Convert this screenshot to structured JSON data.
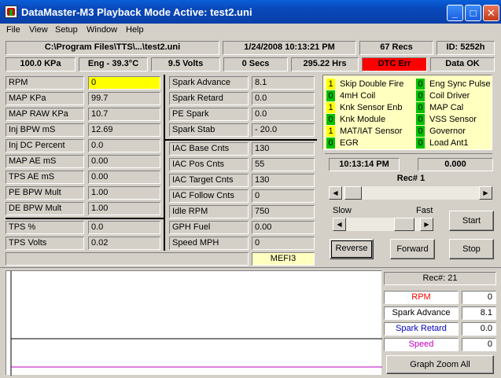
{
  "window": {
    "title": "DataMaster-M3  Playback Mode Active: test2.uni",
    "min_glyph": "_",
    "max_glyph": "□",
    "close_glyph": "✕",
    "icon": "datamaster-app-icon"
  },
  "menu": [
    "File",
    "View",
    "Setup",
    "Window",
    "Help"
  ],
  "status_top": {
    "file": "C:\\Program Files\\TTS\\...\\test2.uni",
    "datetime": "1/24/2008   10:13:21 PM",
    "recs": "67 Recs",
    "id": "ID: 5252h"
  },
  "status_second": {
    "kpa": "100.0 KPa",
    "eng": "Eng - 39.3°C",
    "volts": "9.5 Volts",
    "secs": "0 Secs",
    "hrs": "295.22 Hrs",
    "dtc": "DTC Err",
    "data": "Data OK"
  },
  "colors": {
    "dtc_bg": "#ff0000",
    "highlight": "#ffff00",
    "panel_yellow": "#ffffc0",
    "green_bit": "#00c000"
  },
  "col1": [
    {
      "label": "RPM",
      "value": "0"
    },
    {
      "label": "MAP KPa",
      "value": "99.7"
    },
    {
      "label": "MAP RAW KPa",
      "value": "10.7"
    },
    {
      "label": "Inj BPW mS",
      "value": "12.69"
    },
    {
      "label": "Inj DC Percent",
      "value": "0.0"
    },
    {
      "label": "MAP AE mS",
      "value": "0.00"
    },
    {
      "label": "TPS AE mS",
      "value": "0.00"
    },
    {
      "label": "PE BPW Mult",
      "value": "1.00"
    },
    {
      "label": "DE BPW Mult",
      "value": "1.00"
    },
    {
      "label": "TPS %",
      "value": "0.0"
    },
    {
      "label": "TPS Volts",
      "value": "0.02"
    }
  ],
  "col2": [
    {
      "label": "Spark Advance",
      "value": "8.1"
    },
    {
      "label": "Spark Retard",
      "value": "0.0"
    },
    {
      "label": "PE Spark",
      "value": "0.0"
    },
    {
      "label": "Spark Stab",
      "value": "- 20.0"
    },
    {
      "label": "IAC Base Cnts",
      "value": "130"
    },
    {
      "label": "IAC Pos Cnts",
      "value": "55"
    },
    {
      "label": "IAC Target Cnts",
      "value": "130"
    },
    {
      "label": "IAC Follow Cnts",
      "value": "0"
    },
    {
      "label": "Idle RPM",
      "value": "750"
    },
    {
      "label": "GPH Fuel",
      "value": "0.00"
    },
    {
      "label": "Speed MPH",
      "value": "0"
    }
  ],
  "ecm_label": "MEFI3",
  "status_bits_left": [
    {
      "bit": "1",
      "label": "Skip Double Fire",
      "color": "#ffff00"
    },
    {
      "bit": "0",
      "label": "4mH Coil",
      "color": "#00c000"
    },
    {
      "bit": "1",
      "label": "Knk Sensor Enb",
      "color": "#ffff00"
    },
    {
      "bit": "0",
      "label": "Knk Module",
      "color": "#00c000"
    },
    {
      "bit": "1",
      "label": "MAT/IAT Sensor",
      "color": "#ffff00"
    },
    {
      "bit": "0",
      "label": "EGR",
      "color": "#00c000"
    }
  ],
  "status_bits_right": [
    {
      "bit": "0",
      "label": "Eng Sync Pulse",
      "color": "#00c000"
    },
    {
      "bit": "0",
      "label": "Coil Driver",
      "color": "#00c000"
    },
    {
      "bit": "0",
      "label": "MAP Cal",
      "color": "#00c000"
    },
    {
      "bit": "0",
      "label": "VSS Sensor",
      "color": "#00c000"
    },
    {
      "bit": "0",
      "label": "Governor",
      "color": "#00c000"
    },
    {
      "bit": "0",
      "label": "Load Ant1",
      "color": "#00c000"
    }
  ],
  "playback": {
    "time": "10:13:14 PM",
    "elapsed": "0.000",
    "rec_label": "Rec# 1",
    "rec_position": 0.02,
    "slow_label": "Slow",
    "fast_label": "Fast",
    "speed_position": 0.9,
    "start": "Start",
    "reverse": "Reverse",
    "forward": "Forward",
    "stop": "Stop"
  },
  "graph": {
    "rec_label": "Rec#:  21",
    "legend": [
      {
        "name": "RPM",
        "value": "0",
        "color": "#ff0000"
      },
      {
        "name": "Spark Advance",
        "value": "8.1",
        "color": "#000000"
      },
      {
        "name": "Spark Retard",
        "value": "0.0",
        "color": "#0000c0"
      },
      {
        "name": "Speed",
        "value": "0",
        "color": "#c000c0"
      }
    ],
    "zoom_button": "Graph Zoom All"
  }
}
